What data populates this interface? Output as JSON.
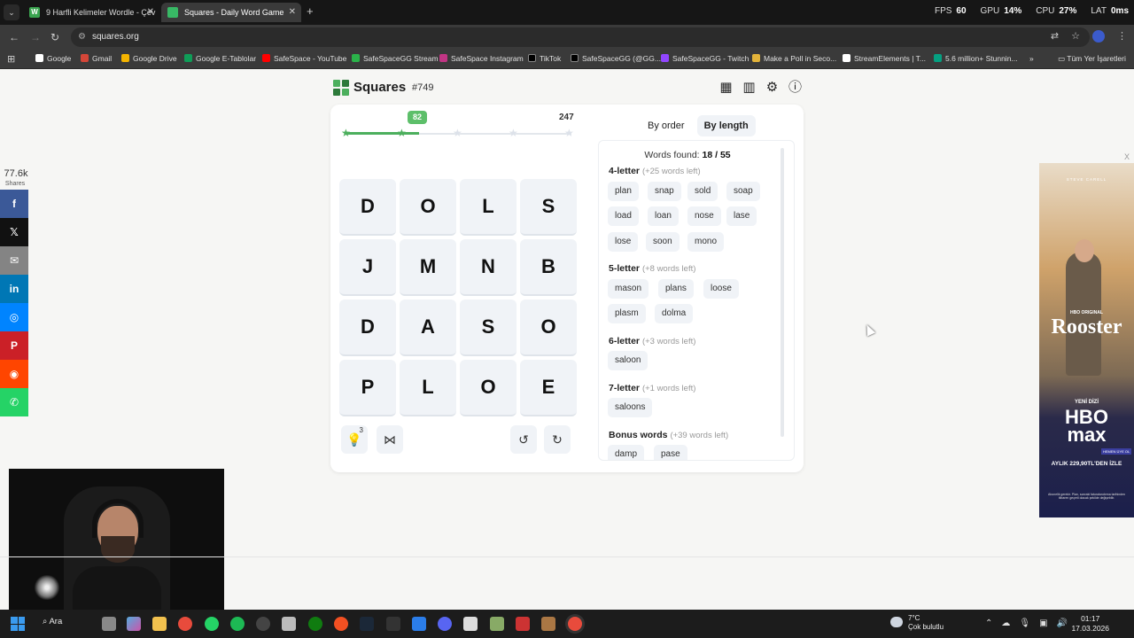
{
  "browser": {
    "tabs": [
      {
        "label": "9 Harfli Kelimeler Wordle - Çev",
        "icon": "W"
      },
      {
        "label": "Squares - Daily Word Game"
      }
    ],
    "new_tab": "+",
    "perf": {
      "fps_label": "FPS",
      "fps": "60",
      "gpu_label": "GPU",
      "gpu": "14%",
      "cpu_label": "CPU",
      "cpu": "27%",
      "lat_label": "LAT",
      "lat": "0ms"
    },
    "url": "squares.org",
    "bookmarks": [
      "Google",
      "Gmail",
      "Google Drive",
      "Google E-Tablolar",
      "SafeSpace - YouTube",
      "SafeSpaceGG Stream",
      "SafeSpace Instagram",
      "TikTok",
      "SafeSpaceGG (@GG...",
      "SafeSpaceGG - Twitch",
      "Make a Poll in Seco...",
      "StreamElements | T...",
      "5.6 million+ Stunnin..."
    ],
    "all_bookmarks": "Tüm Yer İşaretleri",
    "more": "»"
  },
  "game": {
    "title": "Squares",
    "puzzle_number": "#749",
    "progress": {
      "current_score": "82",
      "max_score": "247",
      "fill_fraction": 0.33
    },
    "grid": [
      [
        "D",
        "O",
        "L",
        "S"
      ],
      [
        "J",
        "M",
        "N",
        "B"
      ],
      [
        "D",
        "A",
        "S",
        "O"
      ],
      [
        "P",
        "L",
        "O",
        "E"
      ]
    ],
    "hints_count": "3",
    "modes": {
      "by_order": "By order",
      "by_length": "By length"
    },
    "words_found_label": "Words found:",
    "words_found": "18 / 55",
    "sections": [
      {
        "title": "4-letter",
        "left": "(+25 words left)",
        "words": [
          "plan",
          "snap",
          "sold",
          "soap",
          "load",
          "loan",
          "nose",
          "lase",
          "lose",
          "soon",
          "mono"
        ]
      },
      {
        "title": "5-letter",
        "left": "(+8 words left)",
        "words": [
          "mason",
          "plans",
          "loose",
          "plasm",
          "dolma"
        ]
      },
      {
        "title": "6-letter",
        "left": "(+3 words left)",
        "words": [
          "saloon"
        ]
      },
      {
        "title": "7-letter",
        "left": "(+1 words left)",
        "words": [
          "saloons"
        ]
      },
      {
        "title": "Bonus words",
        "left": "(+39 words left)",
        "words": [
          "damp",
          "pase"
        ]
      }
    ]
  },
  "share": {
    "count": "77.6k",
    "label": "Shares"
  },
  "ad": {
    "actor": "STEVE CARELL",
    "network_small": "HBO ORIGINAL",
    "title": "Rooster",
    "new_series": "YENİ DİZİ",
    "brand_line1": "HBO",
    "brand_line2": "max",
    "cta": "HEMEN ÜYE OL",
    "price": "AYLIK 229,90TL'DEN İZLE",
    "fine_print": "Abonelik gerekir. Plan, sonraki faturalandırma tarihinden itibaren geçerli olacak şekilde değişebilir.",
    "close": "X"
  },
  "taskbar": {
    "search": "Ara",
    "weather_temp": "7°C",
    "weather_desc": "Çok bulutlu",
    "time": "01:17",
    "date": "17.03.2026"
  }
}
